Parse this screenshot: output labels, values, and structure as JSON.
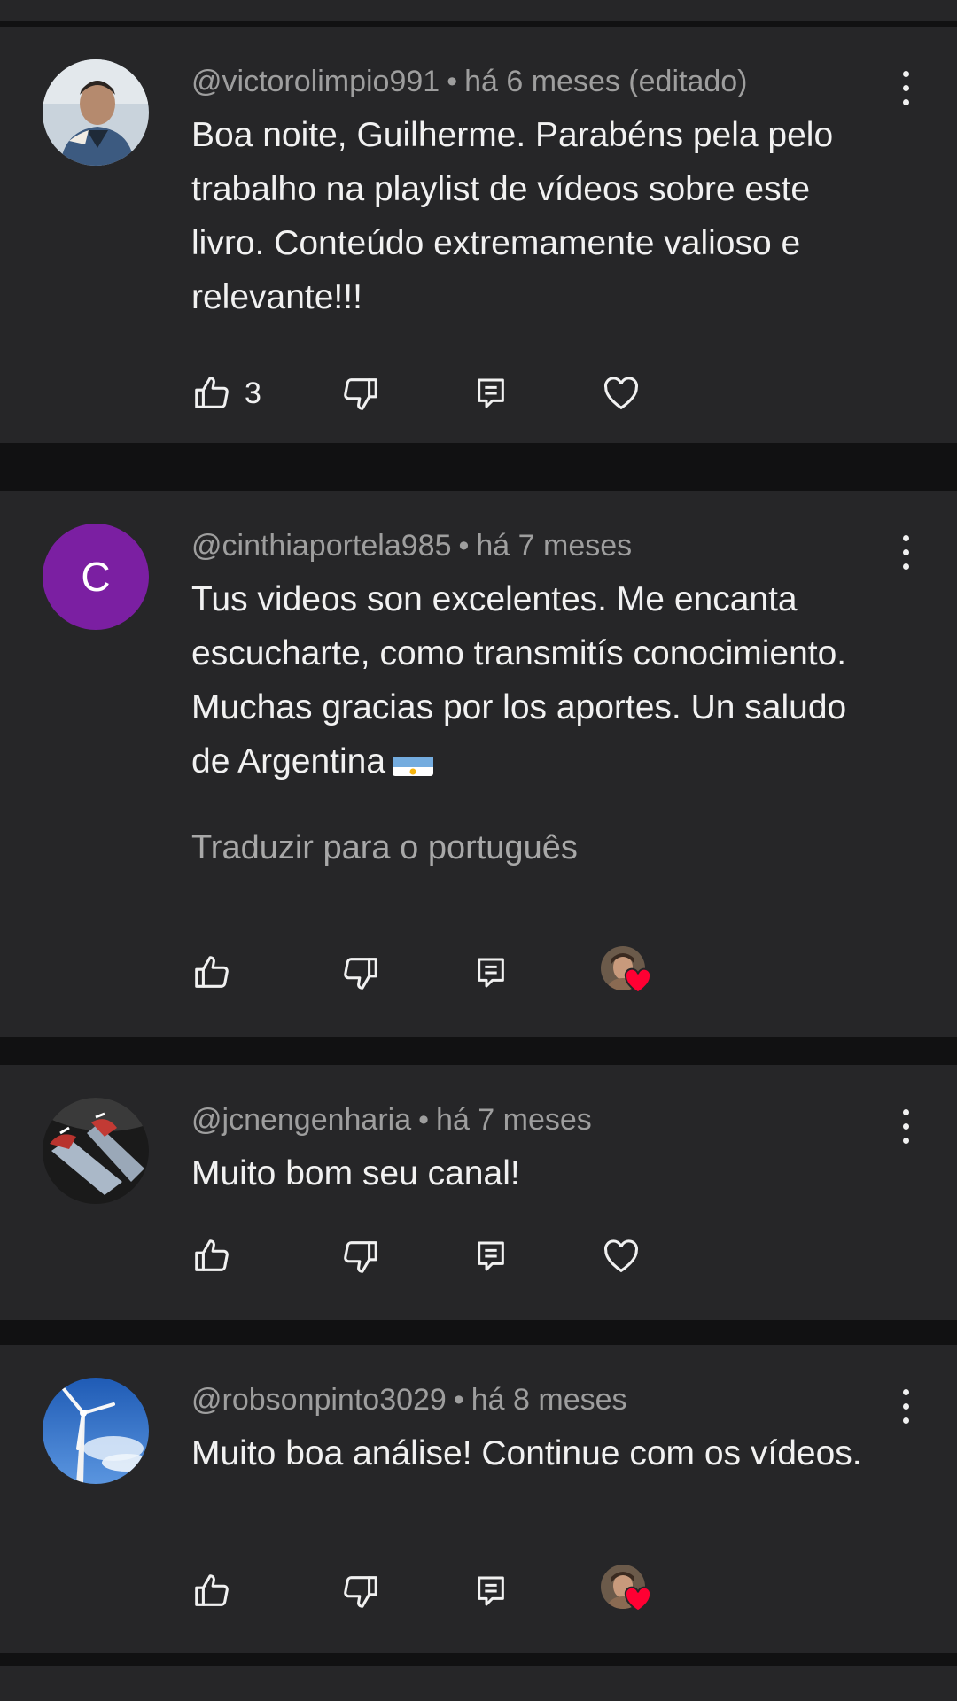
{
  "comments": [
    {
      "author": "@victorolimpio991",
      "time": "há 6 meses (editado)",
      "text": "Boa noite, Guilherme. Parabéns pela pelo trabalho na playlist de vídeos sobre este livro. Conteúdo extremamente valioso e relevante!!!",
      "like_count": "3",
      "avatar": "photo-man-denim-jacket",
      "creator_heart": false
    },
    {
      "author": "@cinthiaportela985",
      "time": "há 7 meses",
      "text": "Tus videos son excelentes. Me encanta escucharte, como transmitís conocimiento. Muchas gracias por los aportes. Un saludo de Argentina",
      "text_emoji": "argentina-flag-emoji",
      "translate_label": "Traduzir para o português",
      "avatar_letter": "C",
      "avatar_color": "#7b1fa2",
      "creator_heart": true
    },
    {
      "author": "@jcnengenharia",
      "time": "há 7 meses",
      "text": "Muito bom seu canal!",
      "avatar": "photo-legs-sneakers",
      "creator_heart": false
    },
    {
      "author": "@robsonpinto3029",
      "time": "há 8 meses",
      "text": "Muito boa análise! Continue com os vídeos.",
      "avatar": "photo-sky-wind-turbine",
      "creator_heart": true
    }
  ],
  "separator": "•",
  "colors": {
    "card_bg": "#262628",
    "page_bg": "#111112",
    "meta_text": "#9e9e9e",
    "body_text": "#f1f1f1",
    "heart_red": "#ff0033"
  }
}
